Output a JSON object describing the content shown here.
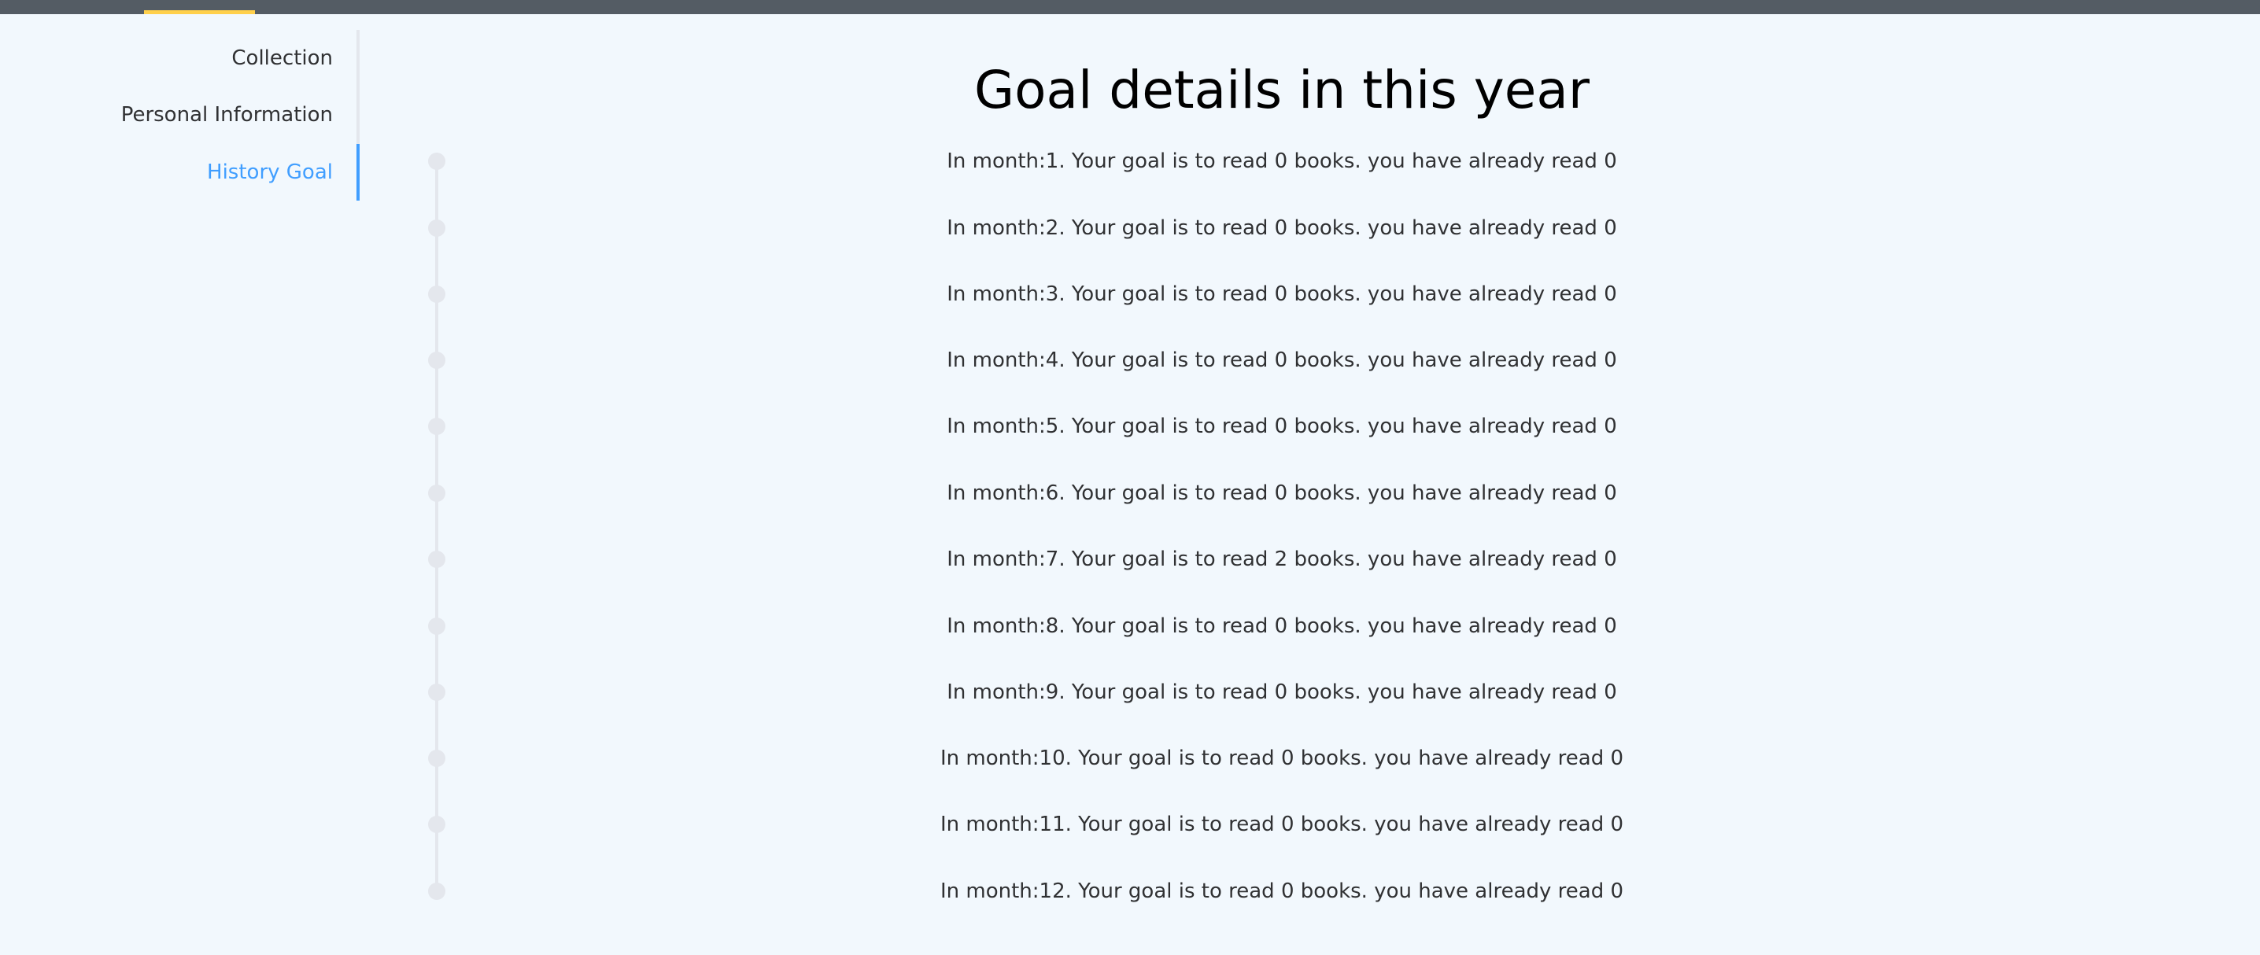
{
  "header": {
    "accent_color": "#ffd04b",
    "background_color": "#545c64"
  },
  "sidebar": {
    "items": [
      {
        "label": "Collection",
        "active": false
      },
      {
        "label": "Personal Information",
        "active": false
      },
      {
        "label": "History Goal",
        "active": true
      }
    ],
    "active_color": "#409eff"
  },
  "main": {
    "title": "Goal details in this year",
    "goals": [
      {
        "text": "In month:1. Your goal is to read 0 books. you have already read 0"
      },
      {
        "text": "In month:2. Your goal is to read 0 books. you have already read 0"
      },
      {
        "text": "In month:3. Your goal is to read 0 books. you have already read 0"
      },
      {
        "text": "In month:4. Your goal is to read 0 books. you have already read 0"
      },
      {
        "text": "In month:5. Your goal is to read 0 books. you have already read 0"
      },
      {
        "text": "In month:6. Your goal is to read 0 books. you have already read 0"
      },
      {
        "text": "In month:7. Your goal is to read 2 books. you have already read 0"
      },
      {
        "text": "In month:8. Your goal is to read 0 books. you have already read 0"
      },
      {
        "text": "In month:9. Your goal is to read 0 books. you have already read 0"
      },
      {
        "text": "In month:10. Your goal is to read 0 books. you have already read 0"
      },
      {
        "text": "In month:11. Your goal is to read 0 books. you have already read 0"
      },
      {
        "text": "In month:12. Your goal is to read 0 books. you have already read 0"
      }
    ]
  }
}
